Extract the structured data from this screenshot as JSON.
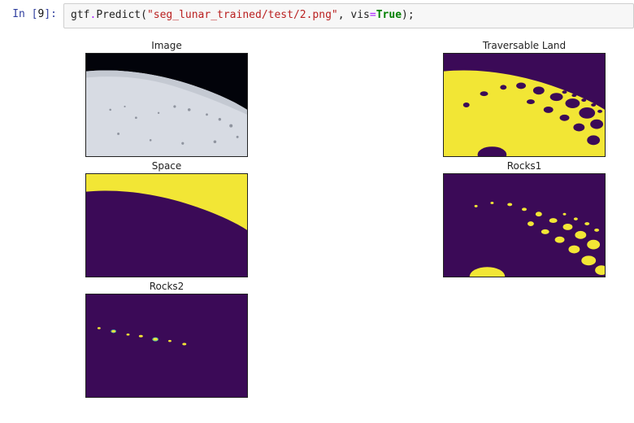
{
  "cell": {
    "prompt_prefix": "In [",
    "prompt_num": "9",
    "prompt_suffix": "]:",
    "code": {
      "obj": "gtf",
      "dot": ".",
      "method": "Predict",
      "open": "(",
      "arg_string": "\"seg_lunar_trained/test/2.png\"",
      "sep": ", ",
      "kw_name": "vis",
      "eq": "=",
      "kw_val": "True",
      "close": ");"
    }
  },
  "plots": {
    "p0": {
      "title": "Image"
    },
    "p1": {
      "title": "Traversable Land"
    },
    "p2": {
      "title": "Space"
    },
    "p3": {
      "title": "Rocks1"
    },
    "p4": {
      "title": "Rocks2"
    }
  },
  "colors": {
    "purple": "#3b0a57",
    "yellow": "#f2e635",
    "black": "#000000"
  }
}
